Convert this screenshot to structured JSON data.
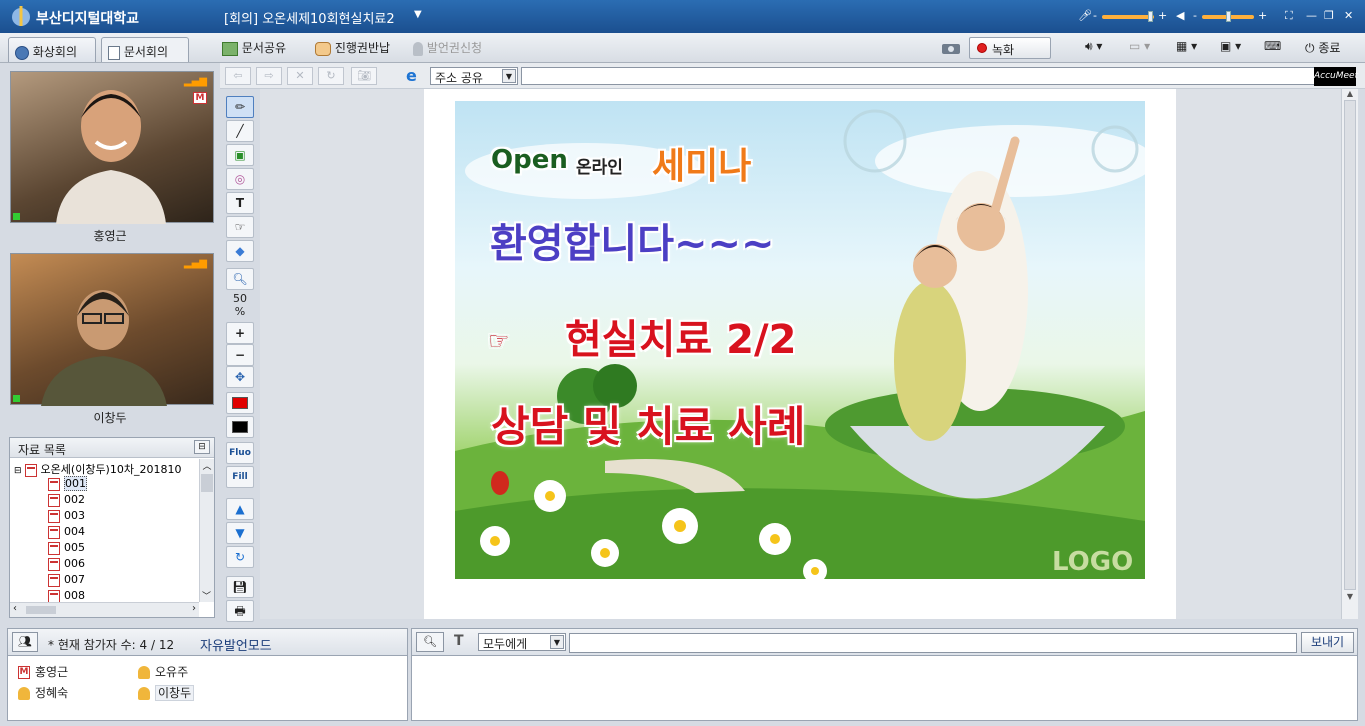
{
  "titlebar": {
    "school": "부산디지털대학교",
    "room": "[회의] 오온세제10회현실치료2"
  },
  "tabs": [
    {
      "label": "화상회의",
      "active": false
    },
    {
      "label": "문서회의",
      "active": true
    }
  ],
  "toolbar": {
    "share_doc": "문서공유",
    "return_control": "진행권반납",
    "request_speak": "발언권신청",
    "record": "녹화",
    "exit": "종료"
  },
  "videos": [
    {
      "name": "홍영근"
    },
    {
      "name": "이창두"
    }
  ],
  "files": {
    "header": "자료 목록",
    "root": "오온세(이창두)10차_201810",
    "pages": [
      "001",
      "002",
      "003",
      "004",
      "005",
      "006",
      "007",
      "008"
    ],
    "selected": "001"
  },
  "drawtools": {
    "zoom": "50",
    "zoom_unit": "%",
    "fluo": "Fluo",
    "fill": "Fill"
  },
  "navbar": {
    "url_mode": "주소 공유",
    "url_value": "",
    "brand": "AccuMeet"
  },
  "slide": {
    "line1_a": "Open",
    "line1_b": "온라인",
    "line1_c": "세미나",
    "line2": "환영합니다~~~",
    "line3": "현실치료  2/2",
    "line4": "상담 및 치료 사례",
    "logo": "LOGO"
  },
  "participants": {
    "count_label": "* 현재 참가자 수: 4 / 12",
    "mode": "자유발언모드",
    "list": [
      {
        "name": "홍영근",
        "role": "host"
      },
      {
        "name": "오유주",
        "role": "member"
      },
      {
        "name": "정혜숙",
        "role": "member"
      },
      {
        "name": "이창두",
        "role": "presenter"
      }
    ]
  },
  "chat": {
    "target": "모두에게",
    "message": "",
    "send": "보내기"
  },
  "colors": {
    "accent": "#1b4f8f",
    "pen_color": "#e00000",
    "fill_color": "#000000"
  }
}
